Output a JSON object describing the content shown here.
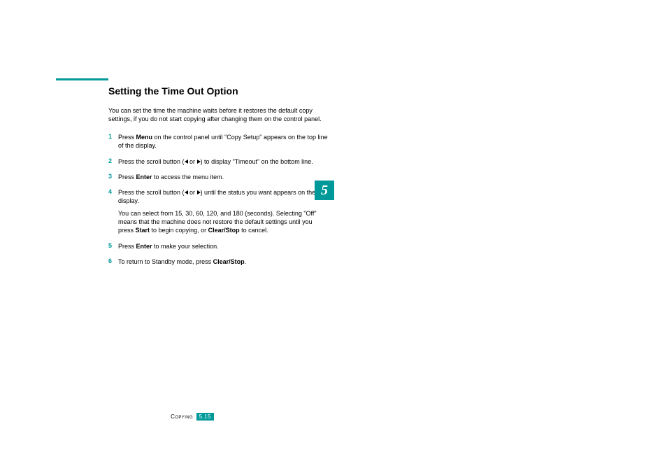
{
  "heading": "Setting the Time Out Option",
  "intro": "You can set the time the machine waits before it restores the default copy settings, if you do not start copying after changing them on the control panel.",
  "steps": {
    "1": {
      "a": "Press ",
      "b": "Menu",
      "c": " on the control panel until \"Copy Setup\" appears on the top line of the display."
    },
    "2": {
      "a": "Press the scroll button (",
      "b": " or ",
      "c": ") to display \"Timeout\" on the bottom line."
    },
    "3": {
      "a": "Press ",
      "b": "Enter",
      "c": " to access the menu item."
    },
    "4": {
      "p1a": "Press the scroll button (",
      "p1b": " or ",
      "p1c": ") until the status you want appears on the display.",
      "p2a": "You can select from 15, 30, 60, 120, and 180 (seconds). Selecting \"Off\" means that the machine does not restore the default settings until you press ",
      "p2b": "Start",
      "p2c": " to begin copying, or ",
      "p2d": "Clear/Stop",
      "p2e": " to cancel."
    },
    "5": {
      "a": "Press ",
      "b": "Enter",
      "c": " to make your selection."
    },
    "6": {
      "a": "To return to Standby mode, press ",
      "b": "Clear/Stop",
      "c": "."
    }
  },
  "chapter": "5",
  "footer": {
    "label": "Copying",
    "page": "5.15"
  }
}
